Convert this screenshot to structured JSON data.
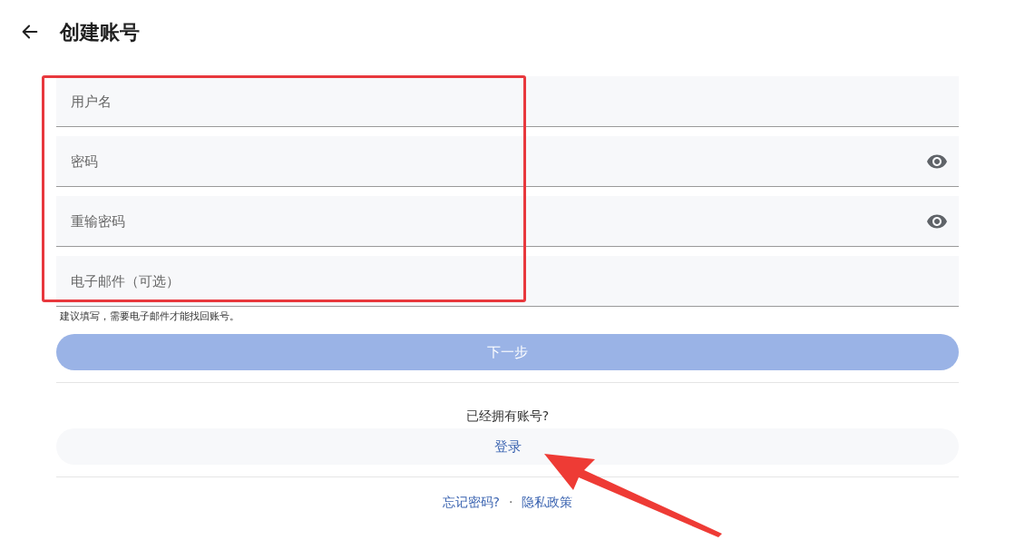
{
  "header": {
    "title": "创建账号"
  },
  "fields": [
    {
      "kind": "text",
      "placeholder": "用户名"
    },
    {
      "kind": "password",
      "placeholder": "密码"
    },
    {
      "kind": "password",
      "placeholder": "重输密码"
    },
    {
      "kind": "text",
      "placeholder": "电子邮件（可选）"
    }
  ],
  "hint": "建议填写，需要电子邮件才能找回账号。",
  "next_button": {
    "label": "下一步",
    "disabled": true
  },
  "have_account": "已经拥有账号?",
  "login_button": {
    "label": "登录"
  },
  "links": [
    "忘记密码?",
    "隐私政策"
  ],
  "separator": "·"
}
